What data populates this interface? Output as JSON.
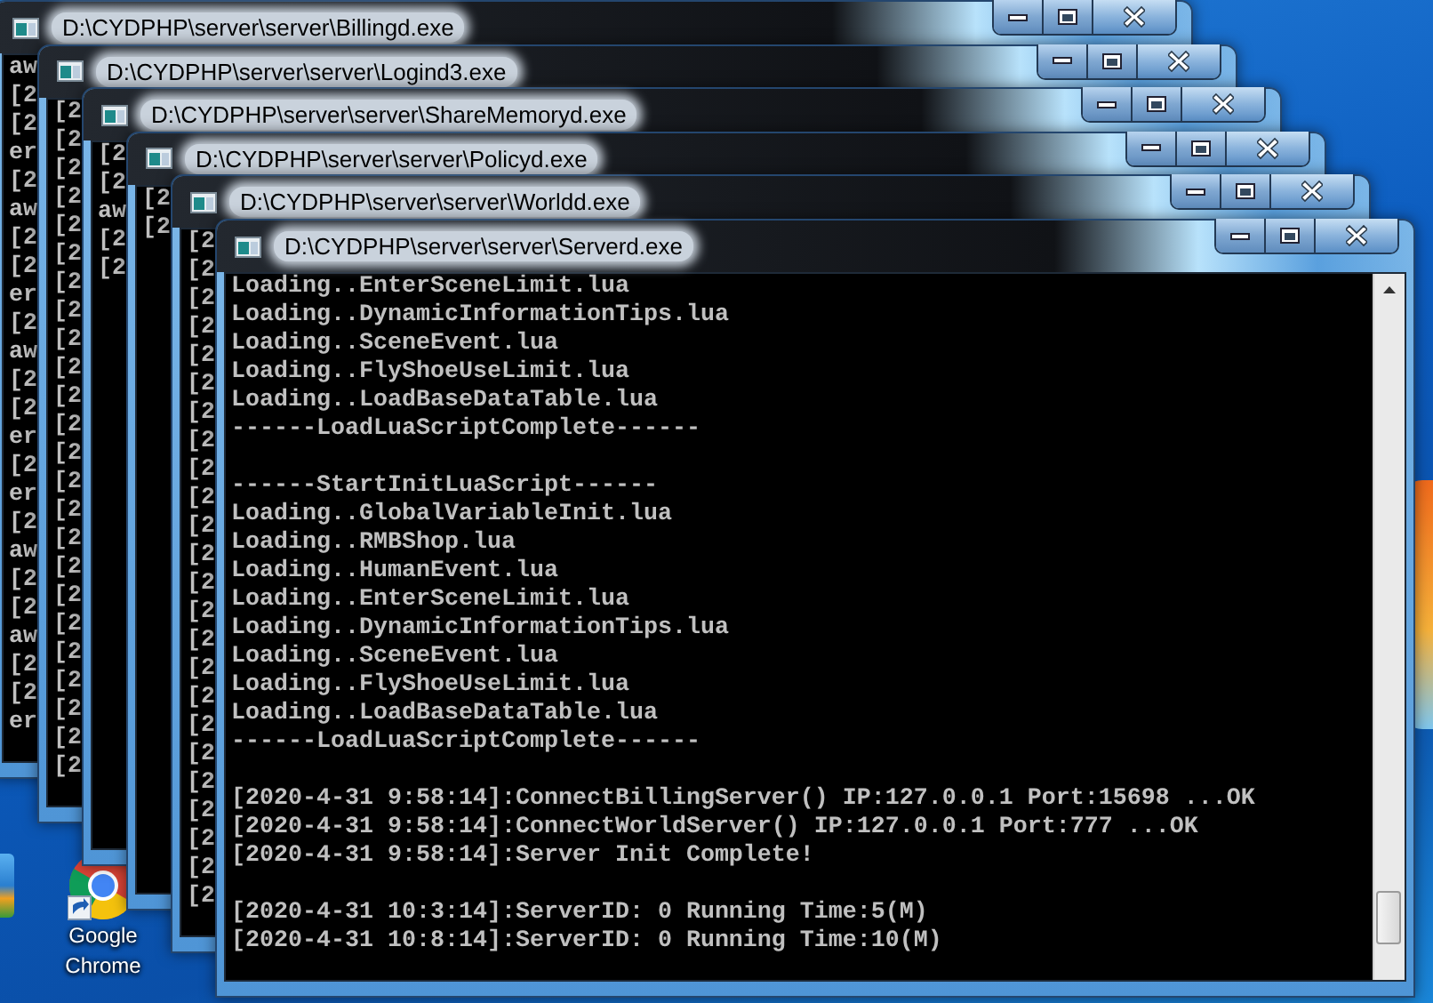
{
  "windows": [
    {
      "title": "D:\\CYDPHP\\server\\server\\Billingd.exe",
      "lines": [
        "aw",
        "[2",
        "[2",
        "er",
        "[2",
        "aw",
        "[2",
        "[2",
        "er",
        "[2",
        "aw",
        "[2",
        "[2",
        "er",
        "[2",
        "er",
        "[2",
        "aw",
        "[2",
        "[2",
        "aw",
        "[2",
        "[2",
        "er"
      ]
    },
    {
      "title": "D:\\CYDPHP\\server\\server\\Logind3.exe",
      "lines": [
        "[2",
        "[2",
        "[2",
        "[2",
        "[2",
        "[2",
        "[2",
        "[2",
        "[2",
        "[2",
        "[2",
        "[2",
        "[2",
        "[2",
        "[2",
        "[2",
        "[2",
        "[2",
        "[2",
        "[2",
        "[2",
        "[2",
        "[2",
        "[2"
      ]
    },
    {
      "title": "D:\\CYDPHP\\server\\server\\ShareMemoryd.exe",
      "lines": [
        "[2",
        "[2",
        "aw",
        "[2",
        "[2"
      ]
    },
    {
      "title": "D:\\CYDPHP\\server\\server\\Policyd.exe",
      "lines": [
        "[2",
        "[2"
      ]
    },
    {
      "title": "D:\\CYDPHP\\server\\server\\Worldd.exe",
      "lines": [
        "[2",
        "[2",
        "[2",
        "[2",
        "[2",
        "[2",
        "[2",
        "[2",
        "[2",
        "[2",
        "[2",
        "[2",
        "[2",
        "[2",
        "[2",
        "[2",
        "[2",
        "[2",
        "[2",
        "[2",
        "[2",
        "[2",
        "[2",
        "[2"
      ]
    },
    {
      "title": "D:\\CYDPHP\\server\\server\\Serverd.exe",
      "blocks": [
        [
          "Loading..EnterSceneLimit.lua",
          "Loading..DynamicInformationTips.lua",
          "Loading..SceneEvent.lua",
          "Loading..FlyShoeUseLimit.lua",
          "Loading..LoadBaseDataTable.lua",
          "------LoadLuaScriptComplete------"
        ],
        [
          "------StartInitLuaScript------",
          "Loading..GlobalVariableInit.lua",
          "Loading..RMBShop.lua",
          "Loading..HumanEvent.lua",
          "Loading..EnterSceneLimit.lua",
          "Loading..DynamicInformationTips.lua",
          "Loading..SceneEvent.lua",
          "Loading..FlyShoeUseLimit.lua",
          "Loading..LoadBaseDataTable.lua",
          "------LoadLuaScriptComplete------"
        ],
        [
          "[2020-4-31 9:58:14]:ConnectBillingServer() IP:127.0.0.1 Port:15698 ...OK",
          "[2020-4-31 9:58:14]:ConnectWorldServer() IP:127.0.0.1 Port:777 ...OK",
          "[2020-4-31 9:58:14]:Server Init Complete!"
        ],
        [
          "[2020-4-31 10:3:14]:ServerID: 0 Running Time:5(M)",
          "[2020-4-31 10:8:14]:ServerID: 0 Running Time:10(M)"
        ]
      ]
    }
  ],
  "desktop_icons": [
    {
      "label": "Google Chrome"
    }
  ]
}
